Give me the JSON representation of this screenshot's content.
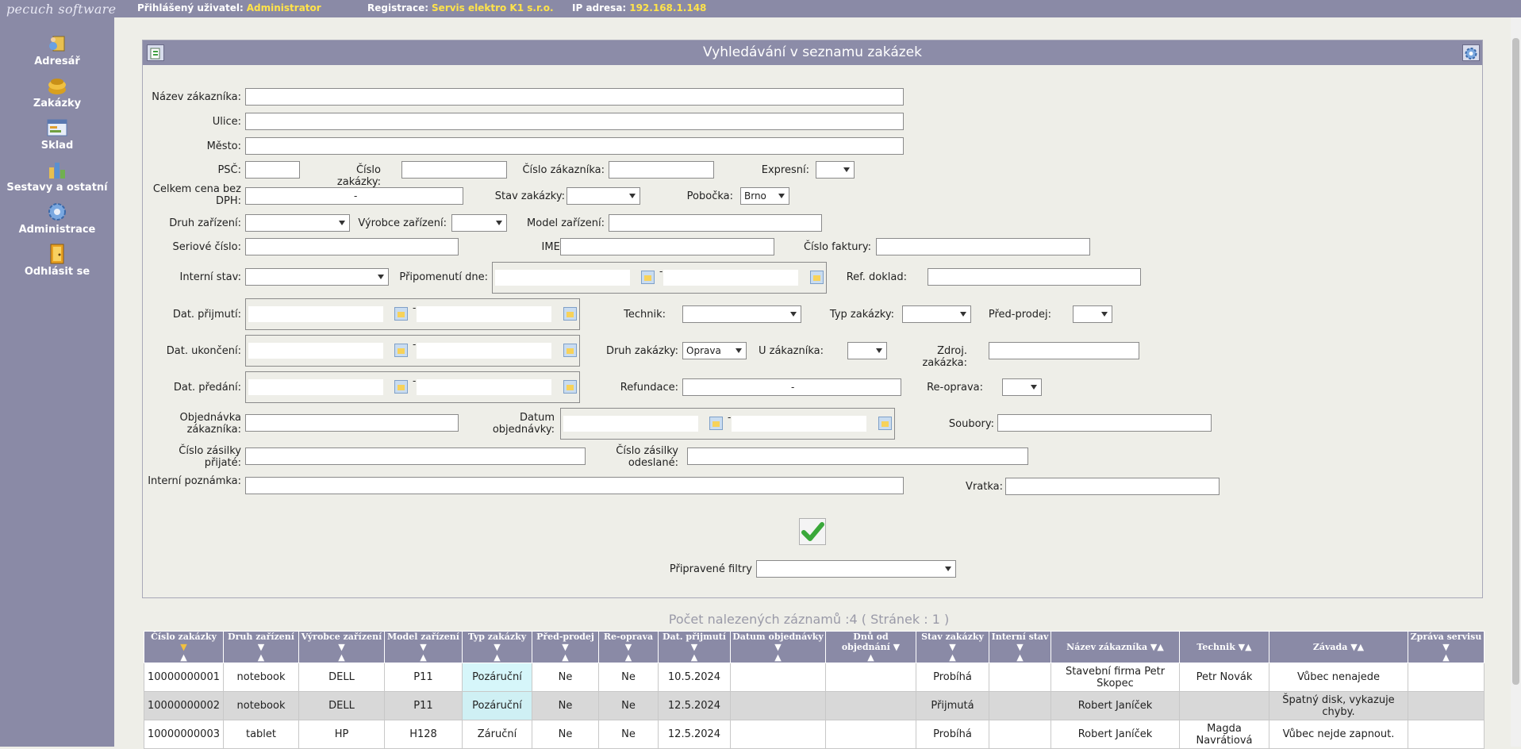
{
  "topbar": {
    "brand": "pecuch software",
    "user_label": "Přihlášený uživatel:",
    "user_value": "Administrator",
    "reg_label": "Registrace:",
    "reg_value": "Servis elektro K1 s.r.o.",
    "ip_label": "IP adresa:",
    "ip_value": "192.168.1.148"
  },
  "sidebar": {
    "items": [
      {
        "label": "Adresář",
        "icon": "address-book-icon"
      },
      {
        "label": "Zakázky",
        "icon": "orders-icon"
      },
      {
        "label": "Sklad",
        "icon": "warehouse-icon"
      },
      {
        "label": "Sestavy a ostatní",
        "icon": "reports-icon"
      },
      {
        "label": "Administrace",
        "icon": "gear-icon"
      },
      {
        "label": "Odhlásit se",
        "icon": "logout-door-icon"
      }
    ]
  },
  "panel": {
    "title": "Vyhledávání v seznamu zakázek"
  },
  "form": {
    "customer_name": "Název zákazníka:",
    "street": "Ulice:",
    "city": "Město:",
    "zip": "PSČ:",
    "order_no": "Číslo zakázky:",
    "customer_no": "Číslo zákazníka:",
    "express": "Expresní:",
    "total_price": "Celkem cena bez DPH:",
    "order_state": "Stav zakázky:",
    "branch": "Pobočka:",
    "branch_value": "Brno",
    "device_type": "Druh zařízení:",
    "manufacturer": "Výrobce zařízení:",
    "model": "Model zařízení:",
    "serial": "Seriové číslo:",
    "imei": "IMEI:",
    "invoice_no": "Číslo faktury:",
    "internal_state": "Interní stav:",
    "reminded": "Připomenutí dne:",
    "ref_doc": "Ref. doklad:",
    "date_received": "Dat. přijmutí:",
    "technician": "Technik:",
    "order_type": "Typ zakázky:",
    "pre_sale": "Před-prodej:",
    "date_finished": "Dat. ukončení:",
    "order_kind": "Druh zakázky:",
    "order_kind_value": "Oprava",
    "at_customer": "U zákazníka:",
    "source_order": "Zdroj. zakázka:",
    "date_handover": "Dat. předání:",
    "refund": "Refundace:",
    "repair_again": "Re-oprava:",
    "customer_order": "Objednávka zákazníka:",
    "order_date": "Datum objednávky:",
    "files": "Soubory:",
    "shipment_in": "Číslo zásilky přijaté:",
    "shipment_out": "Číslo zásilky odeslané:",
    "internal_note": "Interní poznámka:",
    "return": "Vratka:",
    "prepared_filters": "Připravené filtry",
    "range_sep": "-"
  },
  "results": {
    "count_text": "Počet nalezených záznamů :4 ( Stránek : 1 )",
    "columns": [
      "Číslo zakázky",
      "Druh zařízení",
      "Výrobce zařízení",
      "Model zařízení",
      "Typ zakázky",
      "Před-prodej",
      "Re-oprava",
      "Dat. přijmutí",
      "Datum objednávky",
      "Dnů od objednání",
      "Stav zakázky",
      "Interní stav",
      "Název zákazníka",
      "Technik",
      "Závada",
      "Zpráva servisu"
    ],
    "rows": [
      [
        "10000000001",
        "notebook",
        "DELL",
        "P11",
        "Pozáruční",
        "Ne",
        "Ne",
        "10.5.2024",
        "",
        "",
        "Probíhá",
        "",
        "Stavební firma Petr Skopec",
        "Petr Novák",
        "Vůbec nenajede",
        ""
      ],
      [
        "10000000002",
        "notebook",
        "DELL",
        "P11",
        "Pozáruční",
        "Ne",
        "Ne",
        "12.5.2024",
        "",
        "",
        "Přijmutá",
        "",
        "Robert Janíček",
        "",
        "Špatný disk, vykazuje chyby.",
        ""
      ],
      [
        "10000000003",
        "tablet",
        "HP",
        "H128",
        "Záruční",
        "Ne",
        "Ne",
        "12.5.2024",
        "",
        "",
        "Probíhá",
        "",
        "Robert Janíček",
        "Magda Navrátiová",
        "Vůbec nejde zapnout.",
        ""
      ]
    ]
  },
  "colors": {
    "header_bg": "#8a8aa6",
    "accent_yellow": "#ffe34a",
    "highlight_cell": "#d6f6fa"
  }
}
